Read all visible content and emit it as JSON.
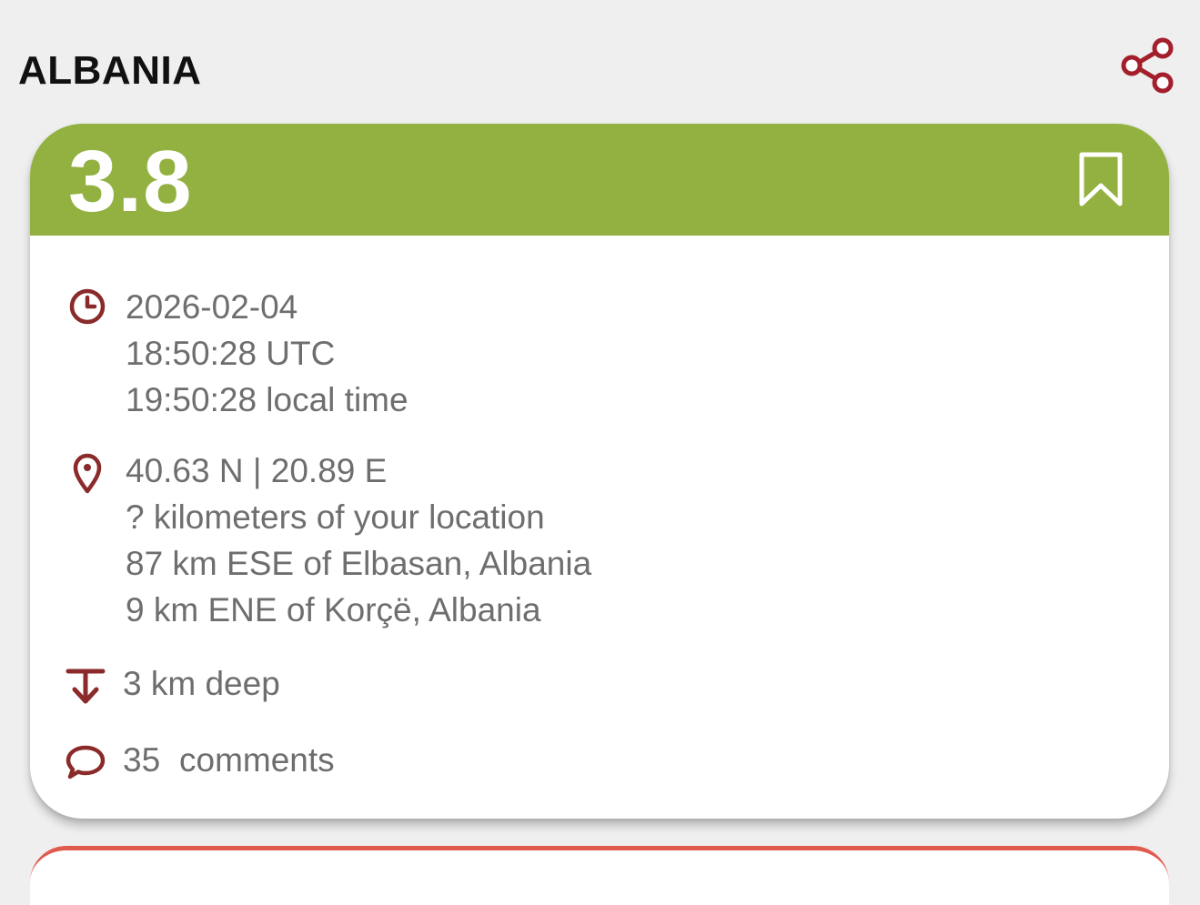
{
  "header": {
    "region": "ALBANIA",
    "share_icon": "share-icon"
  },
  "quake": {
    "magnitude": "3.8",
    "magnitude_color": "#93b141",
    "bookmark_icon": "bookmark-icon",
    "time": {
      "icon": "clock-icon",
      "date": "2026-02-04",
      "utc": "18:50:28 UTC",
      "local": "19:50:28 local time"
    },
    "location": {
      "icon": "location-pin-icon",
      "coords": "40.63 N | 20.89 E",
      "distance": "? kilometers of your location",
      "nearby_1": "87 km ESE of Elbasan, Albania",
      "nearby_2": "9 km ENE of Korçë, Albania"
    },
    "depth": {
      "icon": "depth-arrow-icon",
      "text": "3 km deep"
    },
    "comments": {
      "icon": "comment-bubble-icon",
      "count": "35",
      "label": "comments"
    }
  },
  "colors": {
    "accent_red": "#a31f2b",
    "icon_dark_red": "#8b2a2a",
    "next_card_border": "#e05a4e",
    "background": "#efefef"
  }
}
